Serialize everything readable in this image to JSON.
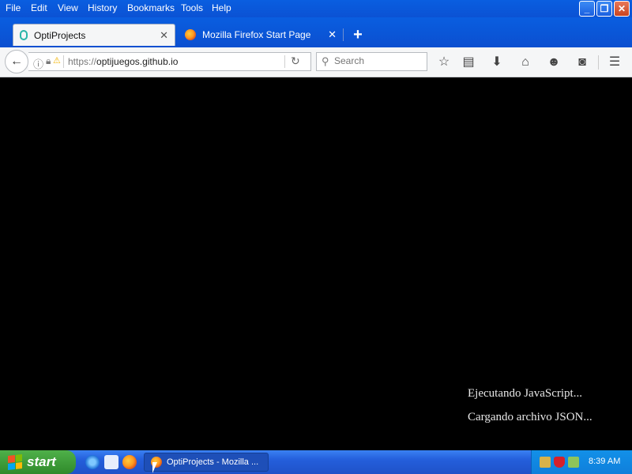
{
  "menu": {
    "items": [
      {
        "label": "File"
      },
      {
        "label": "Edit"
      },
      {
        "label": "View"
      },
      {
        "label": "History"
      },
      {
        "label": "Bookmarks"
      },
      {
        "label": "Tools"
      },
      {
        "label": "Help"
      }
    ]
  },
  "window_controls": {
    "minimize": "_",
    "restore": "❐",
    "close": "✕"
  },
  "tabs": [
    {
      "label": "OptiProjects",
      "close": "✕",
      "active": true
    },
    {
      "label": "Mozilla Firefox Start Page",
      "close": "✕",
      "active": false
    }
  ],
  "new_tab": "+",
  "navbar": {
    "url_prefix": "https://",
    "url_host": "optijuegos.github.io",
    "search_placeholder": "Search"
  },
  "toolbar_icons": [
    "bookmark-star-icon",
    "reading-list-icon",
    "download-icon",
    "home-icon",
    "smiley-icon",
    "pocket-icon",
    "menu-icon"
  ],
  "content": {
    "status_lines": [
      "Ejecutando JavaScript...",
      "Cargando archivo JSON..."
    ]
  },
  "taskbar": {
    "start_label": "start",
    "task_button": "OptiProjects - Mozilla ...",
    "clock": "8:39 AM"
  },
  "colors": {
    "taskbar_blue": "#245edb",
    "start_green": "#2f8a2a",
    "content_bg": "#000000"
  }
}
